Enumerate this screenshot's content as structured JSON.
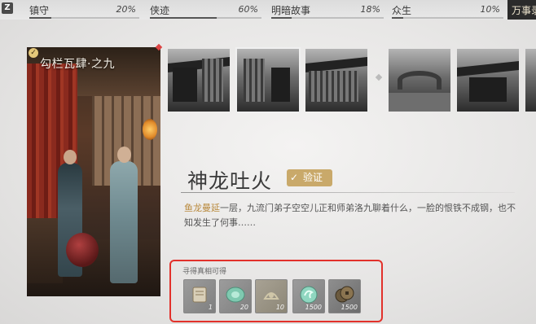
{
  "hotkey": "Z",
  "tabs": [
    {
      "name": "镇守",
      "percent": "20%",
      "progress": 0.2
    },
    {
      "name": "侠迹",
      "percent": "60%",
      "progress": 0.6
    },
    {
      "name": "明暗故事",
      "percent": "18%",
      "progress": 0.18
    },
    {
      "name": "众生",
      "percent": "10%",
      "progress": 0.1
    }
  ],
  "active_tab": {
    "name": "万事录"
  },
  "poster": {
    "title": "勾栏瓦肆·之九",
    "completed": true
  },
  "gallery": {
    "count": 6,
    "selected": 2
  },
  "story": {
    "title": "神龙吐火",
    "status_badge": "验证",
    "desc_highlight": "鱼龙曼延",
    "desc_text": "一层，九流门弟子空空儿正和师弟洛九聊着什么，一脸的恨铁不成钢，也不知发生了何事……"
  },
  "rewards": {
    "label": "寻得真相可得",
    "items": [
      {
        "icon": "scroll-icon",
        "count": "1"
      },
      {
        "icon": "jade-token-icon",
        "count": "20"
      },
      {
        "icon": "relic-icon",
        "count": "10"
      },
      {
        "icon": "swirl-jade-icon",
        "count": "1500"
      },
      {
        "icon": "coin-icon",
        "count": "1500"
      }
    ]
  },
  "colors": {
    "accent_gold": "#c9a96a",
    "highlight_red": "#e2312b",
    "text_highlight": "#b98a3e"
  }
}
